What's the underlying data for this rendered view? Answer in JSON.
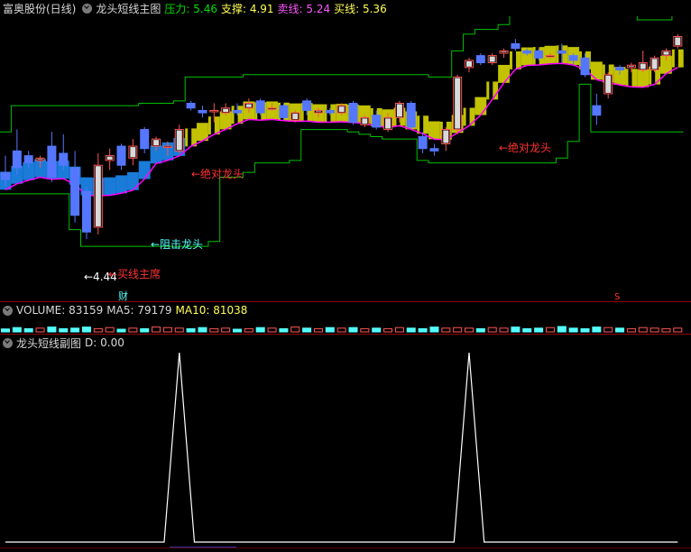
{
  "header": {
    "stock_label": "富奥股份(日线)",
    "indicator_name": "龙头短线主图",
    "pressure_label": "压力: 5.46",
    "support_label": "支撑: 4.91",
    "sell_label": "卖线: 5.24",
    "buy_label": "买线: 5.36"
  },
  "volume_header": {
    "volume_label": "VOLUME: 83159",
    "ma5_label": "MA5: 79179",
    "ma10_label": "MA10: 81038"
  },
  "sub_header": {
    "name": "龙头短线副图",
    "d_label": "D: 0.00"
  },
  "annotations": {
    "absolute_dragon": "←绝对龙头",
    "resist_dragon": "←阻击龙头",
    "low_price": "←4.44",
    "buy_line_main": "←买线主席",
    "absolute_dragon2": "←绝对龙头",
    "cai": "财",
    "s_mark": "S"
  },
  "colors": {
    "up": "#ff5555",
    "down": "#5577ff",
    "pressure": "#00c000",
    "band": "#cccc00",
    "sell_line": "#ff00ff",
    "cyan": "#55ffff",
    "separator": "#8b0000"
  },
  "chart_data": {
    "type": "candlestick",
    "ohlc": [
      [
        4.86,
        4.93,
        4.8,
        4.83
      ],
      [
        4.95,
        5.04,
        4.85,
        4.88
      ],
      [
        4.93,
        4.95,
        4.88,
        4.9
      ],
      [
        4.91,
        4.93,
        4.88,
        4.92
      ],
      [
        4.97,
        5.03,
        4.82,
        4.84
      ],
      [
        4.94,
        5.02,
        4.87,
        4.89
      ],
      [
        4.88,
        4.95,
        4.65,
        4.68
      ],
      [
        4.78,
        4.8,
        4.58,
        4.61
      ],
      [
        4.63,
        4.94,
        4.6,
        4.89
      ],
      [
        4.91,
        4.96,
        4.87,
        4.93
      ],
      [
        4.97,
        4.98,
        4.87,
        4.89
      ],
      [
        4.92,
        5.0,
        4.89,
        4.97
      ],
      [
        5.04,
        5.05,
        4.94,
        4.96
      ],
      [
        4.97,
        5.01,
        4.95,
        5.0
      ],
      [
        4.97,
        4.99,
        4.93,
        4.97
      ],
      [
        4.95,
        5.06,
        4.94,
        5.04
      ],
      [
        5.15,
        5.16,
        5.12,
        5.13
      ],
      [
        5.12,
        5.14,
        5.09,
        5.11
      ],
      [
        5.12,
        5.15,
        5.07,
        5.12
      ],
      [
        5.11,
        5.15,
        5.1,
        5.13
      ],
      [
        5.12,
        5.15,
        5.1,
        5.11
      ],
      [
        5.13,
        5.17,
        5.11,
        5.15
      ],
      [
        5.16,
        5.17,
        5.1,
        5.11
      ],
      [
        5.13,
        5.15,
        5.12,
        5.13
      ],
      [
        5.14,
        5.15,
        5.08,
        5.09
      ],
      [
        5.08,
        5.12,
        5.07,
        5.11
      ],
      [
        5.16,
        5.17,
        5.1,
        5.12
      ],
      [
        5.11,
        5.13,
        5.09,
        5.12
      ],
      [
        5.12,
        5.13,
        5.1,
        5.11
      ],
      [
        5.11,
        5.15,
        5.1,
        5.14
      ],
      [
        5.15,
        5.16,
        5.06,
        5.07
      ],
      [
        5.06,
        5.1,
        5.05,
        5.09
      ],
      [
        5.1,
        5.12,
        5.04,
        5.05
      ],
      [
        5.04,
        5.11,
        5.03,
        5.09
      ],
      [
        5.09,
        5.16,
        5.07,
        5.15
      ],
      [
        5.15,
        5.16,
        5.04,
        5.05
      ],
      [
        5.01,
        5.03,
        4.94,
        4.96
      ],
      [
        4.96,
        4.98,
        4.93,
        4.95
      ],
      [
        4.98,
        5.05,
        4.95,
        5.04
      ],
      [
        5.04,
        5.27,
        5.02,
        5.26
      ],
      [
        5.3,
        5.34,
        5.28,
        5.33
      ],
      [
        5.35,
        5.36,
        5.31,
        5.32
      ],
      [
        5.32,
        5.36,
        5.31,
        5.35
      ],
      [
        5.36,
        5.38,
        5.34,
        5.37
      ],
      [
        5.4,
        5.42,
        5.37,
        5.38
      ],
      [
        5.37,
        5.38,
        5.35,
        5.36
      ],
      [
        5.37,
        5.38,
        5.33,
        5.34
      ],
      [
        5.35,
        5.36,
        5.34,
        5.35
      ],
      [
        5.37,
        5.4,
        5.32,
        5.36
      ],
      [
        5.35,
        5.36,
        5.31,
        5.33
      ],
      [
        5.34,
        5.36,
        5.26,
        5.27
      ],
      [
        5.14,
        5.19,
        5.06,
        5.1
      ],
      [
        5.19,
        5.28,
        5.17,
        5.27
      ],
      [
        5.3,
        5.31,
        5.27,
        5.29
      ],
      [
        5.3,
        5.32,
        5.28,
        5.31
      ],
      [
        5.29,
        5.37,
        5.28,
        5.32
      ],
      [
        5.29,
        5.35,
        5.28,
        5.34
      ],
      [
        5.35,
        5.38,
        5.33,
        5.37
      ],
      [
        5.39,
        5.44,
        5.38,
        5.43
      ]
    ],
    "ylim": [
      4.38,
      5.5
    ],
    "pressure_value": 5.46,
    "support_value": 4.91,
    "sell_value": 5.24,
    "buy_value": 5.36,
    "low_marker": 4.44,
    "volume": [
      0.55,
      0.8,
      0.6,
      0.7,
      0.9,
      0.6,
      0.7,
      0.9,
      0.6,
      0.8,
      0.5,
      0.7,
      0.6,
      0.9,
      0.8,
      0.7,
      0.6,
      0.8,
      0.6,
      0.7,
      0.5,
      0.6,
      0.8,
      0.7,
      0.6,
      0.9,
      0.7,
      0.6,
      0.8,
      0.7,
      0.8,
      0.6,
      0.7,
      0.6,
      0.8,
      0.7,
      0.6,
      0.9,
      0.7,
      0.8,
      0.7,
      0.6,
      0.8,
      0.7,
      0.9,
      0.6,
      0.7,
      0.8,
      1.0,
      0.7,
      0.6,
      0.9,
      0.8,
      0.7,
      0.6,
      0.8,
      0.7,
      0.6,
      0.7
    ],
    "signal_peaks": [
      15,
      40
    ]
  }
}
